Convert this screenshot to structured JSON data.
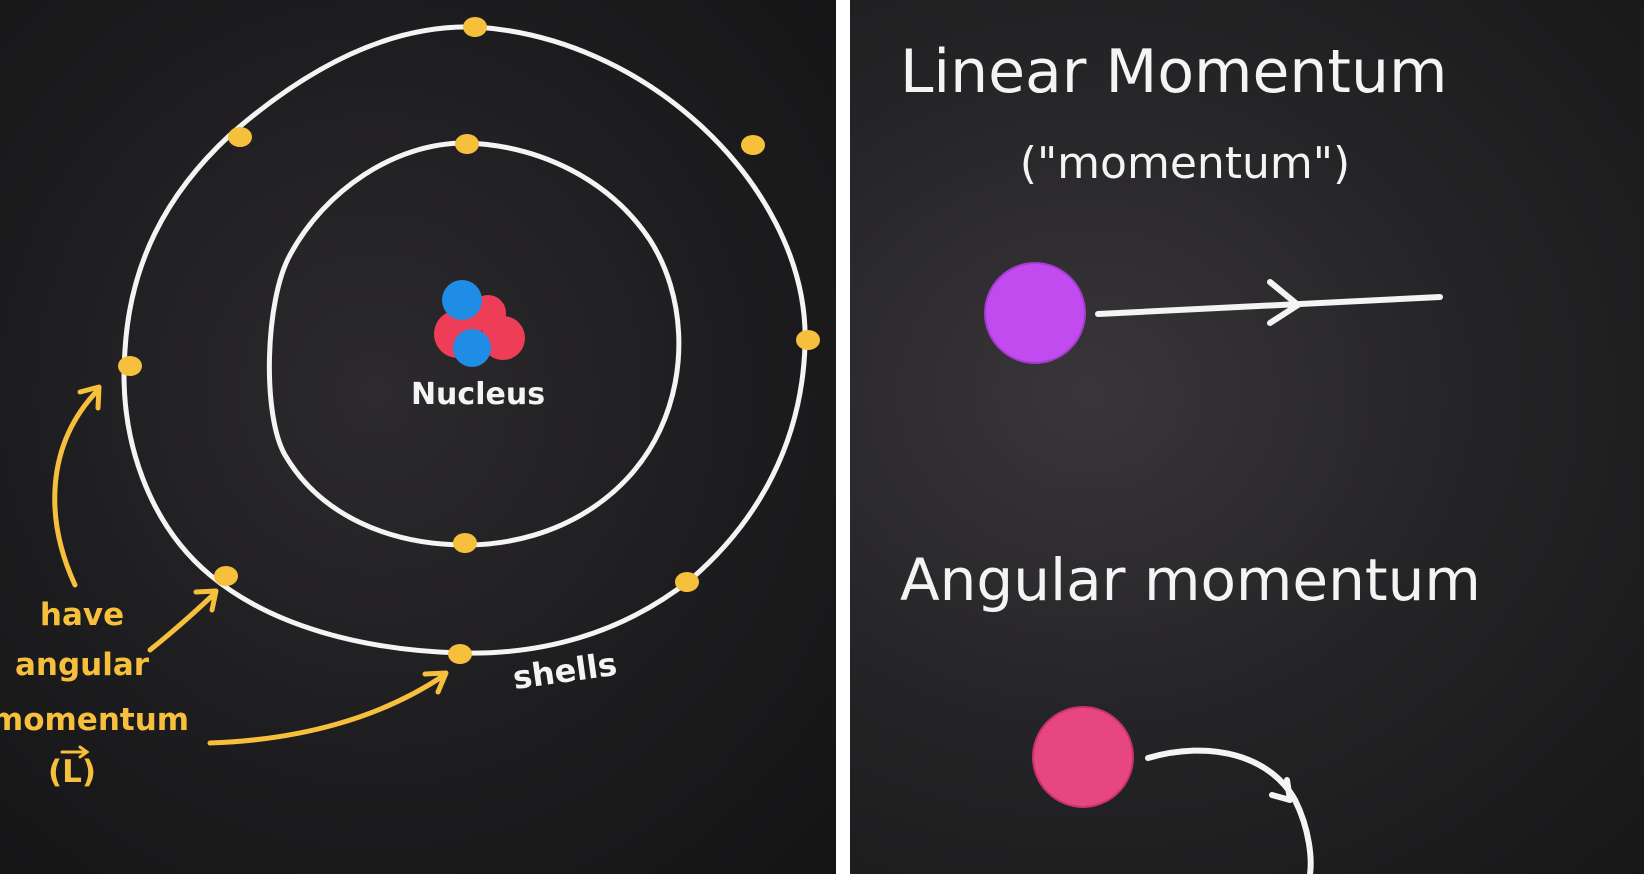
{
  "left_panel": {
    "nucleus_label": "Nucleus",
    "shells_label": "shells",
    "annotation_lines": [
      "have",
      "angular",
      "momentum",
      "(L)"
    ],
    "colors": {
      "orbit": "#f4f4f4",
      "electron": "#f6bf3c",
      "annotation": "#f6bf3c",
      "proton": "#ee3d56",
      "neutron": "#1f8de6"
    }
  },
  "right_panel": {
    "linear_title": "Linear Momentum",
    "linear_subtitle": "(\"momentum\")",
    "angular_title": "Angular momentum",
    "colors": {
      "linear_ball": "#c24bf0",
      "angular_ball": "#e8467f",
      "text": "#f4f4f4"
    }
  }
}
